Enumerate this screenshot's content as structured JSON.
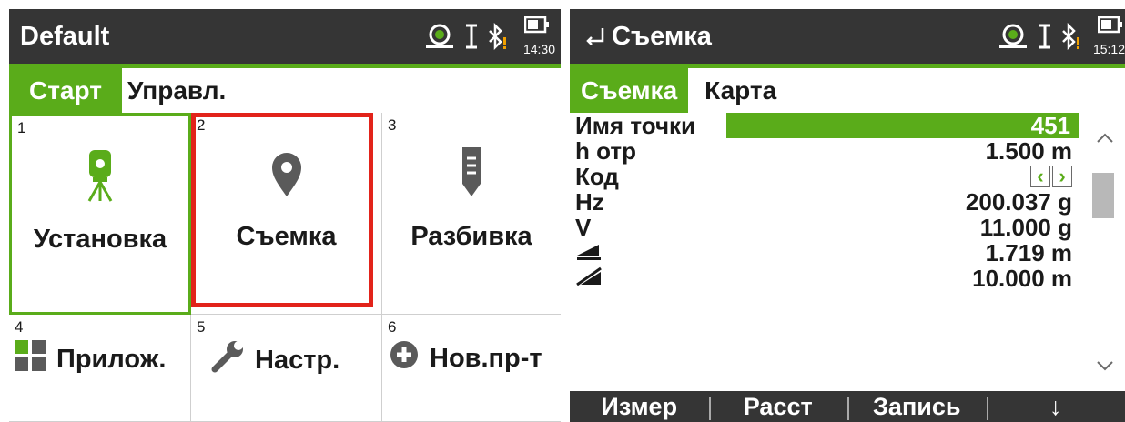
{
  "left": {
    "title": "Default",
    "time": "14:30",
    "tabs": [
      "Старт",
      "Управл."
    ],
    "tiles": [
      {
        "num": "1",
        "label": "Установка",
        "icon": "total-station-icon"
      },
      {
        "num": "2",
        "label": "Съемка",
        "icon": "map-pin-icon"
      },
      {
        "num": "3",
        "label": "Разбивка",
        "icon": "stakeout-pole-icon"
      },
      {
        "num": "4",
        "label": "Прилож.",
        "icon": "apps-grid-icon"
      },
      {
        "num": "5",
        "label": "Настр.",
        "icon": "wrench-icon"
      },
      {
        "num": "6",
        "label": "Нов.пр-т",
        "icon": "plus-circle-icon"
      }
    ]
  },
  "right": {
    "title": "Съемка",
    "time": "15:12",
    "tabs": [
      "Съемка",
      "Карта"
    ],
    "fields": [
      {
        "label": "Имя точки",
        "value": "451"
      },
      {
        "label": "h отр",
        "value": "1.500 m"
      },
      {
        "label": "Код",
        "value": ""
      },
      {
        "label": "Hz",
        "value": "200.037 g"
      },
      {
        "label": "V",
        "value": "11.000 g"
      },
      {
        "label": "",
        "value": "1.719 m"
      },
      {
        "label": "",
        "value": "10.000 m"
      }
    ],
    "softkeys": [
      "Измер",
      "Расст",
      "Запись",
      "↓"
    ]
  },
  "colors": {
    "accent": "#5aac1a",
    "bar": "#353535",
    "highlight": "#e2231a"
  }
}
